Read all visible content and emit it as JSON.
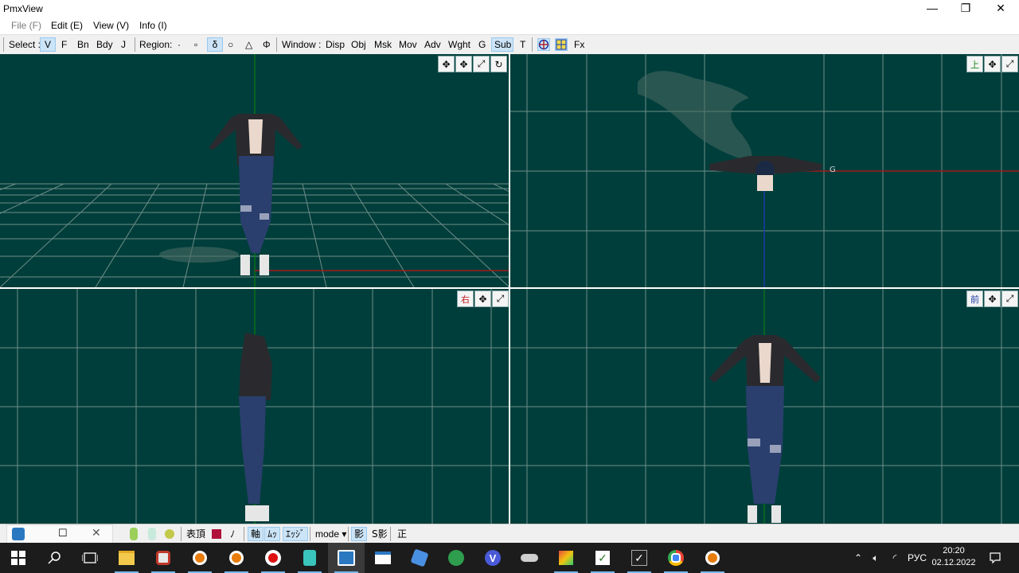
{
  "window": {
    "title": "PmxView",
    "minimize_glyph": "—",
    "restore_glyph": "❐",
    "close_glyph": "✕"
  },
  "menu": [
    {
      "label": "File (F)",
      "enabled": false
    },
    {
      "label": "Edit (E)",
      "enabled": true
    },
    {
      "label": "View (V)",
      "enabled": true
    },
    {
      "label": "Info (I)",
      "enabled": true
    }
  ],
  "toolbar": {
    "select_label": "Select :",
    "select_items": [
      {
        "label": "V",
        "active": true
      },
      {
        "label": "F",
        "active": false
      },
      {
        "label": "Bn",
        "active": false
      },
      {
        "label": "Bdy",
        "active": false
      },
      {
        "label": "J",
        "active": false
      }
    ],
    "region_label": "Region:",
    "region_items": [
      {
        "label": "·",
        "active": false
      },
      {
        "label": "▫",
        "active": false
      },
      {
        "label": "δ",
        "active": true
      },
      {
        "label": "○",
        "active": false
      },
      {
        "label": "△",
        "active": false
      },
      {
        "label": "Φ",
        "active": false
      }
    ],
    "window_label": "Window :",
    "window_items": [
      {
        "label": "Disp",
        "active": false
      },
      {
        "label": "Obj",
        "active": false
      },
      {
        "label": "Msk",
        "active": false
      },
      {
        "label": "Mov",
        "active": false
      },
      {
        "label": "Adv",
        "active": false
      },
      {
        "label": "Wght",
        "active": false
      },
      {
        "label": "G",
        "active": false
      },
      {
        "label": "Sub",
        "active": true
      },
      {
        "label": "T",
        "active": false
      }
    ],
    "fx_label": "Fx"
  },
  "viewports": {
    "perspective": {
      "buttons": [
        "✥",
        "✥",
        "⤢",
        "↻"
      ]
    },
    "top": {
      "view_label": "上",
      "buttons": [
        "✥",
        "⤢"
      ],
      "marker": "G"
    },
    "side": {
      "view_label": "右",
      "buttons": [
        "✥",
        "⤢"
      ]
    },
    "front": {
      "view_label": "前",
      "buttons": [
        "✥",
        "⤢"
      ]
    }
  },
  "viewport_strip": {
    "items": [
      {
        "label": "表頂",
        "active": false
      },
      {
        "label": "ﾉ",
        "active": false
      },
      {
        "label": "軸",
        "active": true
      },
      {
        "label": "ﾑｯ",
        "active": true
      },
      {
        "label": "ｴｯｼﾞ",
        "active": true
      },
      {
        "label": "mode",
        "active": false
      },
      {
        "label": "影",
        "active": true
      },
      {
        "label": "S影",
        "active": false
      },
      {
        "label": "正",
        "active": false
      }
    ]
  },
  "colors": {
    "viewport_bg": "#003e3b",
    "grid": "#6f8d87",
    "axis_x": "#a31a1a",
    "axis_y": "#0a8a0a",
    "axis_z": "#1a3aa8",
    "active_button": "#cce4f7",
    "taskbar": "#1c1c1c"
  },
  "taskbar": {
    "apps": [
      "start-icon",
      "search-icon",
      "task-view-icon",
      "file-explorer-icon",
      "fox-app-icon",
      "blender-icon",
      "blender-icon",
      "record-icon",
      "vocaloid-icon",
      "pmxview-icon",
      "window-app-icon",
      "puzzle-icon",
      "leaf-icon",
      "v-app-icon",
      "cat-app-icon",
      "paint-icon",
      "check-app-icon",
      "check-app-icon",
      "chrome-icon",
      "blender-icon"
    ],
    "tray": {
      "lang": "РУС",
      "time": "20:20",
      "date": "02.12.2022"
    }
  }
}
